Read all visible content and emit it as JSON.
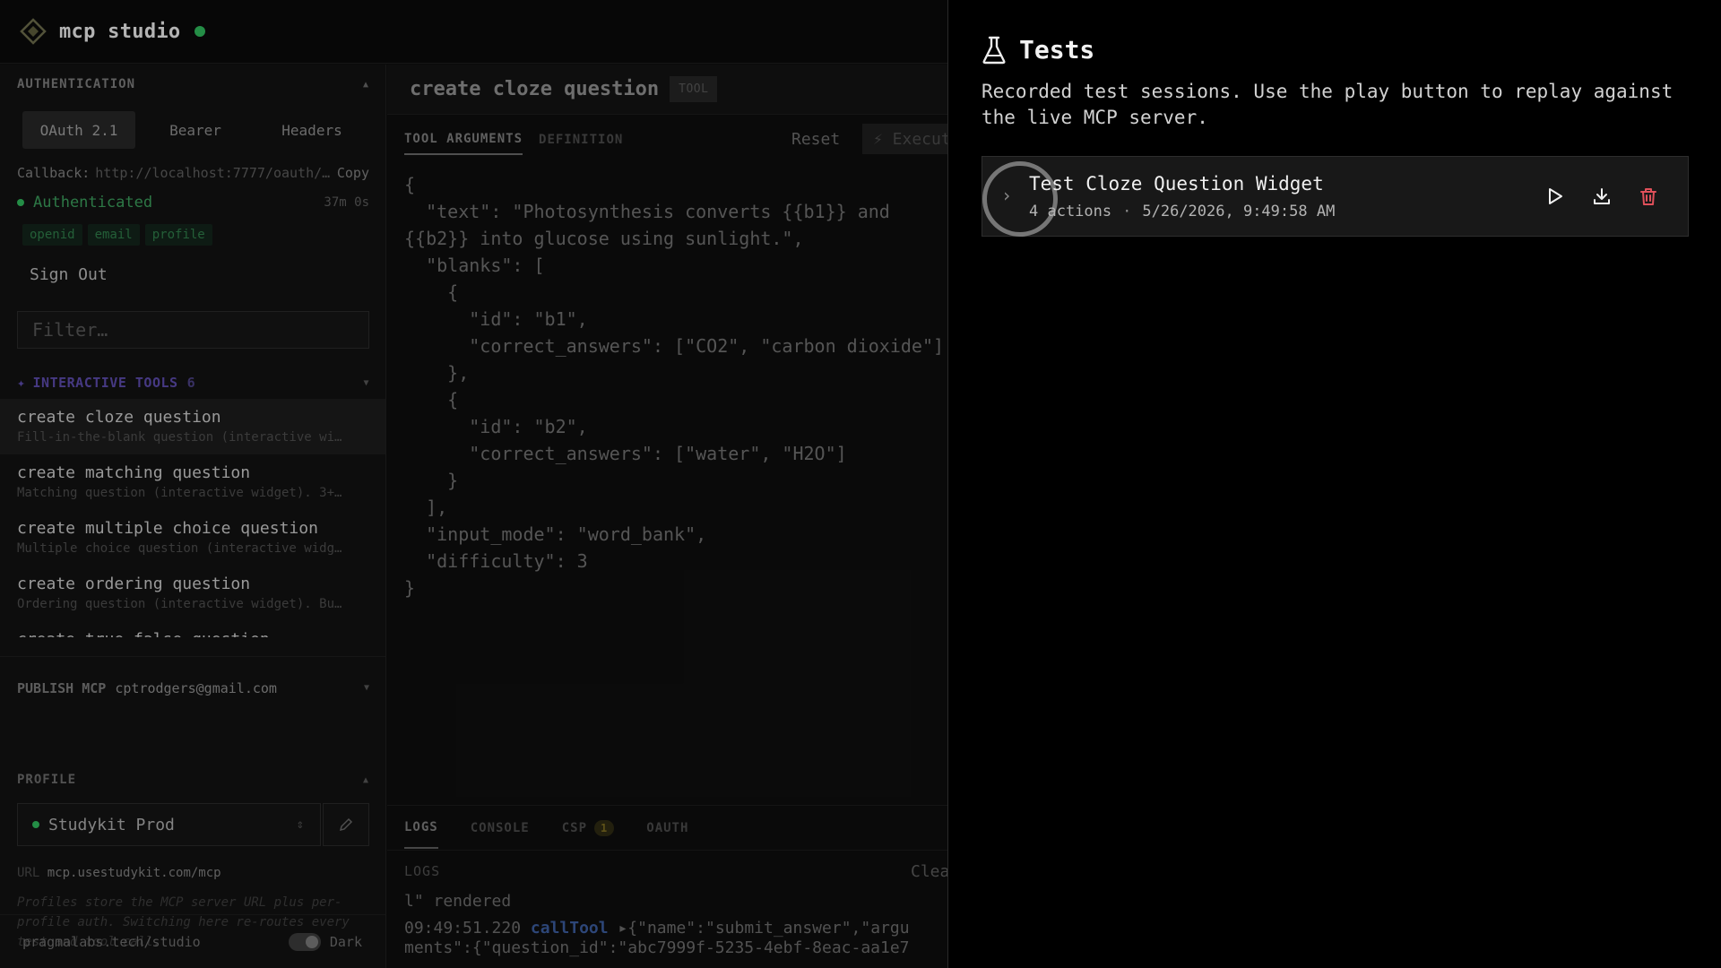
{
  "app": {
    "title": "mcp studio"
  },
  "auth": {
    "section_label": "AUTHENTICATION",
    "tabs": [
      "OAuth 2.1",
      "Bearer",
      "Headers"
    ],
    "callback_label": "Callback:",
    "callback_url": "http://localhost:7777/oauth/…",
    "copy_label": "Copy",
    "status": "Authenticated",
    "expiry": "37m 0s",
    "scopes": [
      "openid",
      "email",
      "profile"
    ],
    "signout_label": "Sign Out"
  },
  "filter": {
    "placeholder": "Filter…"
  },
  "tools_section": {
    "label": "INTERACTIVE TOOLS",
    "count": "6",
    "items": [
      {
        "name": "create cloze question",
        "desc": "Fill-in-the-blank question (interactive wi…"
      },
      {
        "name": "create matching question",
        "desc": "Matching question (interactive widget). 3+…"
      },
      {
        "name": "create multiple choice question",
        "desc": "Multiple choice question (interactive widg…"
      },
      {
        "name": "create ordering question",
        "desc": "Ordering question (interactive widget). Bu…"
      },
      {
        "name": "create true false question",
        "desc": ""
      }
    ]
  },
  "publish": {
    "label": "PUBLISH MCP",
    "email": "cptrodgers@gmail.com"
  },
  "profile": {
    "label": "PROFILE",
    "selected": "Studykit Prod",
    "url_label": "URL",
    "url": "mcp.usestudykit.com/mcp",
    "note": "Profiles store the MCP server URL plus per-profile auth. Switching here re-routes every test and tool call."
  },
  "footer": {
    "site": "pragmalabs.tech/studio",
    "theme_label": "Dark"
  },
  "tool_view": {
    "title": "create cloze question",
    "badge": "TOOL",
    "tabs": [
      "TOOL ARGUMENTS",
      "DEFINITION"
    ],
    "reset_label": "Reset",
    "execute_label": "⚡ Execute",
    "code": "{\n  \"text\": \"Photosynthesis converts {{b1}} and\n{{b2}} into glucose using sunlight.\",\n  \"blanks\": [\n    {\n      \"id\": \"b1\",\n      \"correct_answers\": [\"CO2\", \"carbon dioxide\"]\n    },\n    {\n      \"id\": \"b2\",\n      \"correct_answers\": [\"water\", \"H2O\"]\n    }\n  ],\n  \"input_mode\": \"word_bank\",\n  \"difficulty\": 3\n}"
  },
  "logs": {
    "tabs": [
      "LOGS",
      "CONSOLE",
      "CSP",
      "OAUTH"
    ],
    "csp_count": "1",
    "header": "LOGS",
    "clear_label": "Clear",
    "line1": "l\" rendered",
    "line2_time": "09:49:51.220",
    "line2_fn": "callTool",
    "line2_arrow": "▸",
    "line2_payload": "{\"name\":\"submit_answer\",\"argu",
    "line3": "ments\":{\"question_id\":\"abc7999f-5235-4ebf-8eac-aa1e7"
  },
  "tests_drawer": {
    "title": "Tests",
    "description": "Recorded test sessions. Use the play button to replay against the live MCP server.",
    "sessions": [
      {
        "name": "Test Cloze Question Widget",
        "actions": "4 actions",
        "separator": "·",
        "recorded_at": "5/26/2026, 9:49:58 AM"
      }
    ]
  },
  "colors": {
    "accent_green": "#2fb55a",
    "tools_purple": "#5a49a8",
    "delete_red": "#e0505a"
  },
  "icons": [
    "logo-icon",
    "flask-icon",
    "chevron-right-icon",
    "play-icon",
    "download-icon",
    "trash-icon",
    "pencil-icon",
    "wand-icon"
  ]
}
